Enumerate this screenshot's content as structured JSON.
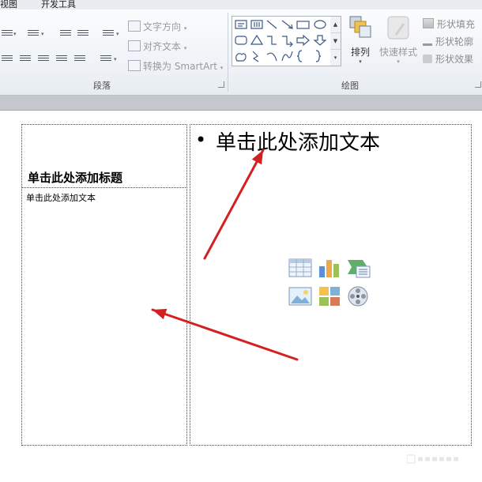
{
  "tabs": [
    {
      "label": "视图"
    },
    {
      "label": "开发工具"
    }
  ],
  "paragraph_group": {
    "label": "段落",
    "text_direction": "文字方向",
    "align_text": "对齐文本",
    "convert_smartart": "转换为 SmartArt"
  },
  "drawing_group": {
    "label": "绘图",
    "arrange": "排列",
    "quick_styles": "快速样式",
    "shape_fill": "形状填充",
    "shape_outline": "形状轮廓",
    "shape_effects": "形状效果"
  },
  "slide": {
    "title_placeholder": "单击此处添加标题",
    "left_text_placeholder": "单击此处添加文本",
    "content_placeholder": "单击此处添加文本",
    "bullet": "•"
  },
  "content_icons": [
    "insert-table-icon",
    "insert-chart-icon",
    "insert-smartart-icon",
    "insert-picture-icon",
    "insert-clipart-icon",
    "insert-media-icon"
  ],
  "annotation": {
    "arrow_color": "#d42020"
  }
}
